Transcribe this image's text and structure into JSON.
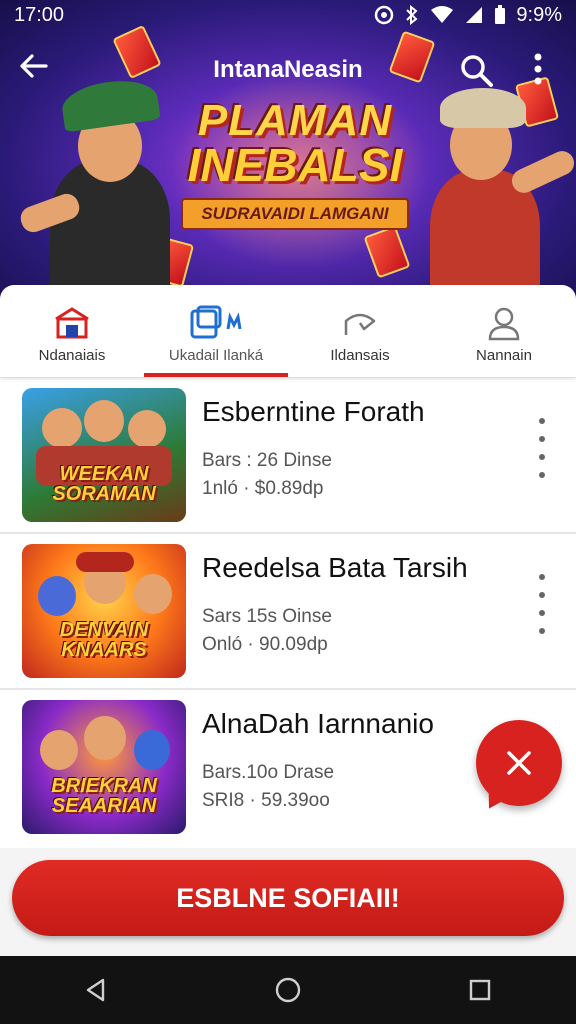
{
  "status_bar": {
    "time": "17:00",
    "battery": "9:9%"
  },
  "app_bar": {
    "title": "IntanaNeasin",
    "back_icon": "arrow-back-icon",
    "search_icon": "search-icon",
    "more_icon": "more-vert-icon"
  },
  "hero": {
    "logo_line1": "PLAMAN",
    "logo_line2": "INEBALSI",
    "ribbon": "SUDRAVAIDI LAMGANI"
  },
  "tabs": [
    {
      "label": "Ndanaiais",
      "icon": "store-icon",
      "active": false
    },
    {
      "label": "Ukadail Ilanká",
      "icon": "games-icon",
      "active": true
    },
    {
      "label": "Ildansais",
      "icon": "share-icon",
      "active": false
    },
    {
      "label": "Nannain",
      "icon": "profile-icon",
      "active": false
    }
  ],
  "items": [
    {
      "name": "Esberntine Forath",
      "meta1": "Bars : 26  Dinse",
      "meta2": "1nló · $0.89dp",
      "thumb_text": "WEEKAN SORAMAN"
    },
    {
      "name": "Reedelsa Bata Tarsih",
      "meta1": "Sars 15s  Oinse",
      "meta2": "Onló · 90.09dp",
      "thumb_text": "DENVAIN KNAARS"
    },
    {
      "name": "AlnaDah Iarnnanio",
      "meta1": "Bars.10o  Drase",
      "meta2": "SRI8 · 59.39oo",
      "thumb_text": "BRIEKRAN SEAARIAN"
    }
  ],
  "fab": {
    "icon": "close-icon",
    "color": "#d8221f"
  },
  "cta": {
    "label": "ESBLNE SOFIAII!"
  },
  "colors": {
    "accent": "#d8221f"
  },
  "nav_bar": {
    "back": "nav-back-icon",
    "home": "nav-home-icon",
    "recents": "nav-recents-icon"
  }
}
